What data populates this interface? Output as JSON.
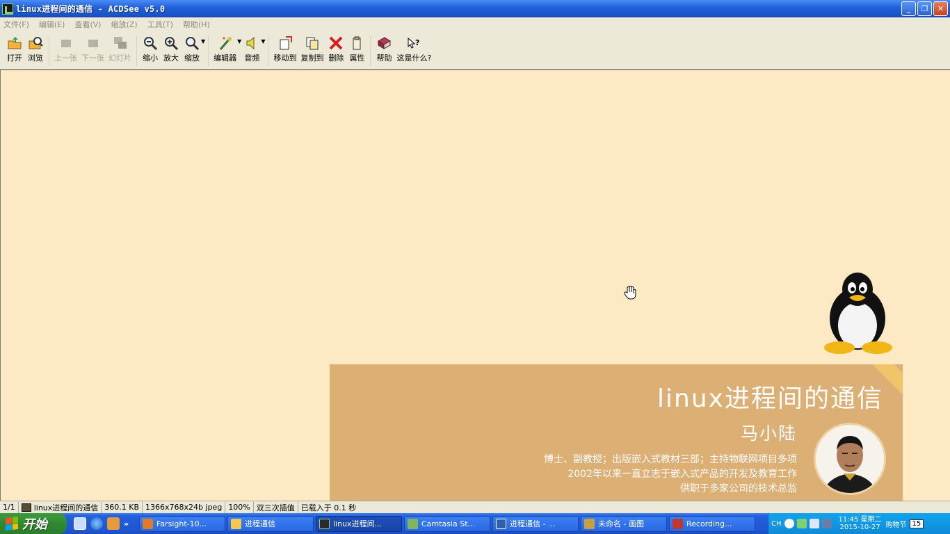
{
  "window": {
    "title": "linux进程间的通信 - ACDSee v5.0"
  },
  "menu": [
    "文件(F)",
    "编辑(E)",
    "查看(V)",
    "缩放(Z)",
    "工具(T)",
    "帮助(H)"
  ],
  "toolbar": {
    "open": "打开",
    "browse": "浏览",
    "prev": "上一张",
    "next": "下一张",
    "slideshow": "幻灯片",
    "zoom_out": "缩小",
    "zoom_in": "放大",
    "zoom": "缩放",
    "editor": "编辑器",
    "audio": "音频",
    "move_to": "移动到",
    "copy_to": "复制到",
    "delete": "删除",
    "properties": "属性",
    "help": "帮助",
    "whats_this": "这是什么?"
  },
  "slide": {
    "course_title": "linux进程间的通信",
    "author": "马小陆",
    "bio": [
      "博士、副教授；出版嵌入式教材三部；主持物联网项目多项",
      "2002年以来一直立志于嵌入式产品的开发及教育工作",
      "供职于多家公司的技术总监"
    ],
    "accent_color": "#dcaf74",
    "background_color": "#fde9c3"
  },
  "statusbar": {
    "index": "1/1",
    "filename": "linux进程间的通信",
    "size": "360.1 KB",
    "dims": "1366x768x24b jpeg",
    "zoom": "100%",
    "interp": "双三次插值",
    "load": "已载入于 0.1 秒"
  },
  "taskbar": {
    "start": "开始",
    "tasks": [
      {
        "label": "Farsight-10...",
        "color": "#e07b2a"
      },
      {
        "label": "进程通信",
        "color": "#f2c94c"
      },
      {
        "label": "linux进程间...",
        "color": "#2b2b2b"
      },
      {
        "label": "Camtasia St...",
        "color": "#7fb85a"
      },
      {
        "label": "进程通信 - ...",
        "color": "#2e5fb0"
      },
      {
        "label": "未命名 - 画图",
        "color": "#c9a13b"
      },
      {
        "label": "Recording...",
        "color": "#c0392b"
      }
    ],
    "tray": {
      "lang": "CH",
      "time": "11:45 星期二",
      "date": "2015-10-27",
      "festival": "购物节",
      "day": "15"
    }
  }
}
